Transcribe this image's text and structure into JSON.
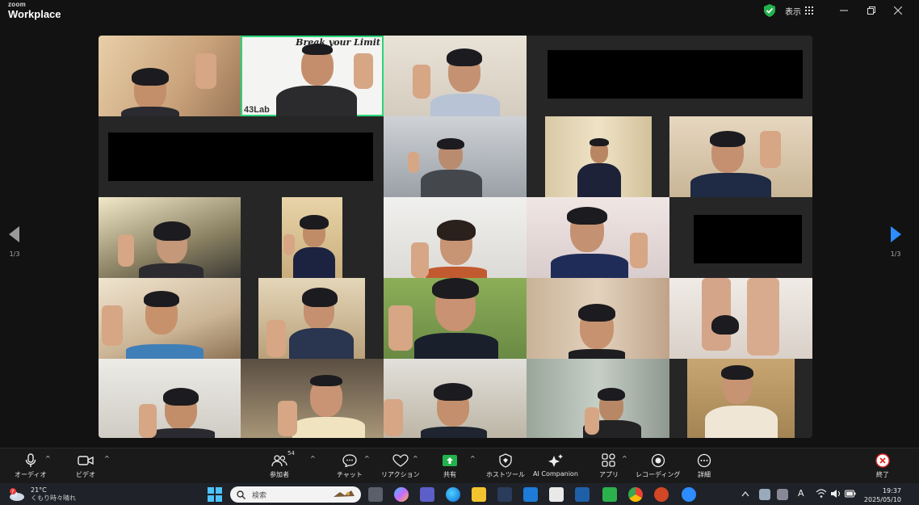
{
  "app": {
    "brand_top": "zoom",
    "brand_bottom": "Workplace",
    "view_label": "表示"
  },
  "gallery": {
    "banner_text": "Break your Limit",
    "logo_text": "43Lab",
    "page_indicator_left": "1/3",
    "page_indicator_right": "1/3"
  },
  "toolbar": {
    "audio": "オーディオ",
    "video": "ビデオ",
    "participants": "参加者",
    "participants_count": "54",
    "chat": "チャット",
    "reactions": "リアクション",
    "share": "共有",
    "host_tools": "ホストツール",
    "ai_companion": "AI Companion",
    "apps": "アプリ",
    "recording": "レコーディング",
    "more": "詳細",
    "end": "終了"
  },
  "taskbar": {
    "weather_temp": "21°C",
    "weather_desc": "くもり時々晴れ",
    "weather_badge": "7",
    "search_placeholder": "検索",
    "time": "19:37",
    "date": "2025/05/10"
  },
  "colors": {
    "active_speaker": "#2bd47a",
    "share_green": "#22b14c",
    "end_red": "#e02828",
    "pager_blue": "#2d8cff"
  }
}
